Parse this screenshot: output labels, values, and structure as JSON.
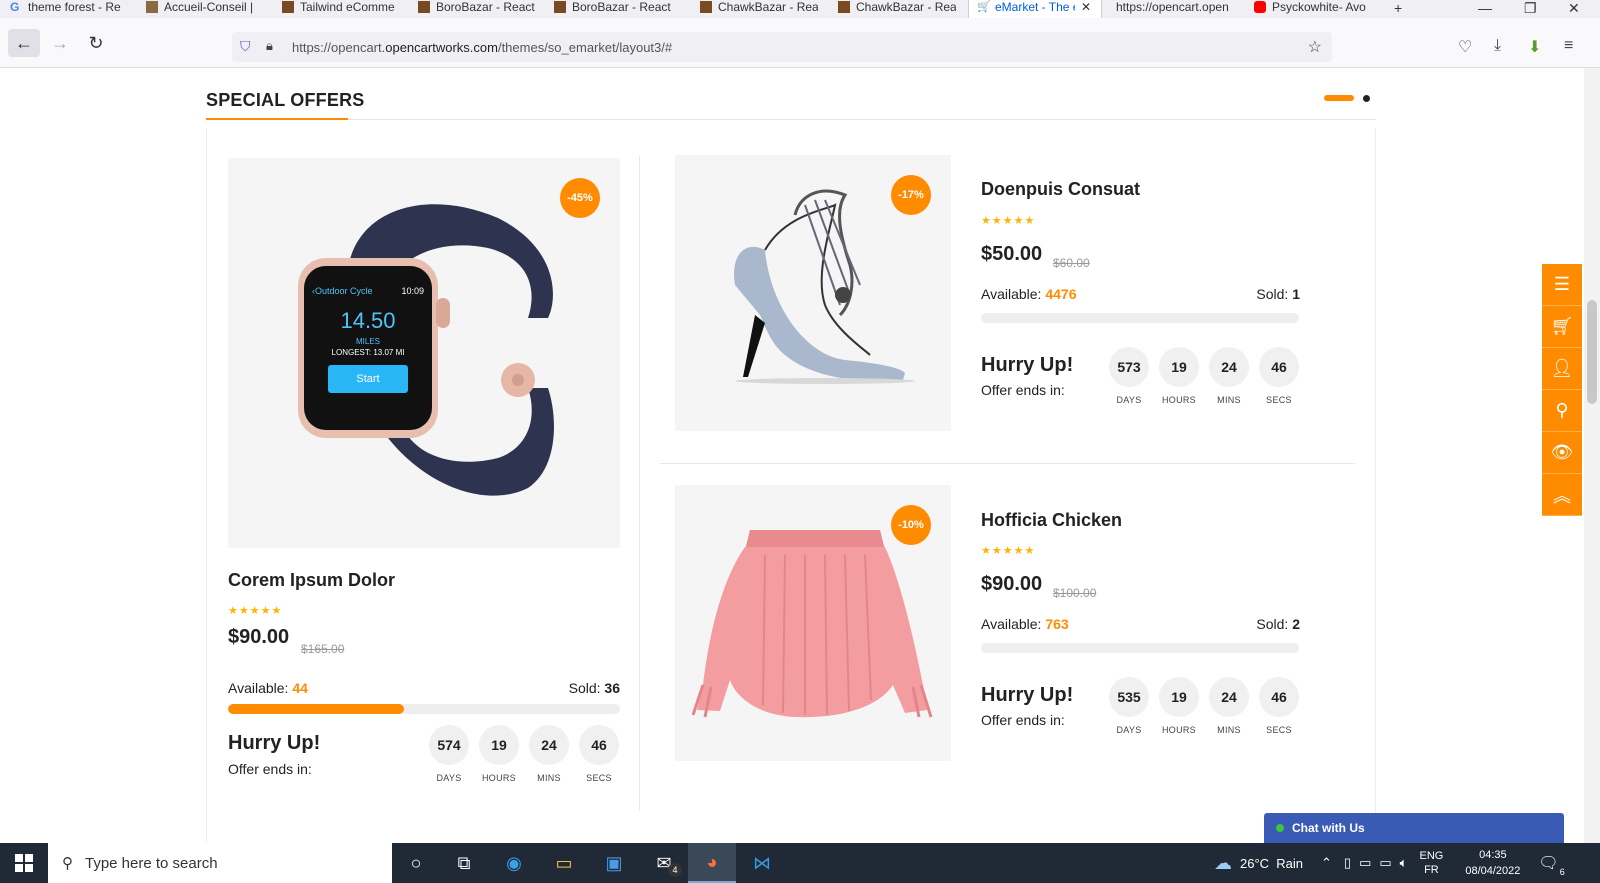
{
  "browser": {
    "tabs": [
      {
        "label": "theme forest - Re",
        "icon": "google-icon"
      },
      {
        "label": "Accueil-Conseil |",
        "icon": "site-icon"
      },
      {
        "label": "Tailwind eComme",
        "icon": "site-icon"
      },
      {
        "label": "BoroBazar - React",
        "icon": "site-icon"
      },
      {
        "label": "BoroBazar - React",
        "icon": "site-icon"
      },
      {
        "label": "ChawkBazar - Rea",
        "icon": "site-icon"
      },
      {
        "label": "ChawkBazar - Rea",
        "icon": "site-icon"
      },
      {
        "label": "eMarket - The e",
        "icon": "cart-icon",
        "active": true
      },
      {
        "label": "https://opencart.open",
        "icon": "none"
      },
      {
        "label": "Psyckowhite- Avo",
        "icon": "youtube-icon"
      }
    ],
    "new_tab": "+",
    "url": {
      "prefix": "https://opencart.",
      "domain": "opencartworks.com",
      "path": "/themes/so_emarket/layout3/#"
    }
  },
  "section": {
    "title": "SPECIAL OFFERS"
  },
  "products": [
    {
      "name": "Corem Ipsum Dolor",
      "discount": "-45%",
      "stars": "★★★★★",
      "price": "$90.00",
      "old_price": "$165.00",
      "available_label": "Available:",
      "available": "44",
      "sold_label": "Sold:",
      "sold": "36",
      "progress": 0.45,
      "hurry": "Hurry Up!",
      "ends": "Offer ends in:",
      "countdown": [
        {
          "value": "574",
          "label": "DAYS"
        },
        {
          "value": "19",
          "label": "HOURS"
        },
        {
          "value": "24",
          "label": "MINS"
        },
        {
          "value": "46",
          "label": "SECS"
        }
      ],
      "watch_screen": {
        "app": "‹Outdoor Cycle",
        "time": "10:09",
        "value": "14.50",
        "unit": "MILES",
        "longest": "LONGEST: 13.07 MI",
        "start": "Start"
      }
    },
    {
      "name": "Doenpuis Consuat",
      "discount": "-17%",
      "stars": "★★★★★",
      "price": "$50.00",
      "old_price": "$60.00",
      "available_label": "Available:",
      "available": "4476",
      "sold_label": "Sold:",
      "sold": "1",
      "progress": 0.0,
      "hurry": "Hurry Up!",
      "ends": "Offer ends in:",
      "countdown": [
        {
          "value": "573",
          "label": "DAYS"
        },
        {
          "value": "19",
          "label": "HOURS"
        },
        {
          "value": "24",
          "label": "MINS"
        },
        {
          "value": "46",
          "label": "SECS"
        }
      ]
    },
    {
      "name": "Hofficia Chicken",
      "discount": "-10%",
      "stars": "★★★★★",
      "price": "$90.00",
      "old_price": "$100.00",
      "available_label": "Available:",
      "available": "763",
      "sold_label": "Sold:",
      "sold": "2",
      "progress": 0.0,
      "hurry": "Hurry Up!",
      "ends": "Offer ends in:",
      "countdown": [
        {
          "value": "535",
          "label": "DAYS"
        },
        {
          "value": "19",
          "label": "HOURS"
        },
        {
          "value": "24",
          "label": "MINS"
        },
        {
          "value": "46",
          "label": "SECS"
        }
      ]
    }
  ],
  "side_tools": [
    "menu-icon",
    "cart-icon",
    "user-icon",
    "search-icon",
    "eye-icon",
    "scroll-top-icon"
  ],
  "chat": {
    "label": "Chat with Us"
  },
  "taskbar": {
    "search_placeholder": "Type here to search",
    "mail_badge": "4",
    "weather": "26°C  Rain",
    "lang_top": "ENG",
    "lang_bottom": "FR",
    "time": "04:35",
    "date": "08/04/2022",
    "notif_count": "6"
  },
  "colors": {
    "accent": "#ff8c00",
    "star": "#ffb400",
    "chat": "#3a5bb5"
  }
}
